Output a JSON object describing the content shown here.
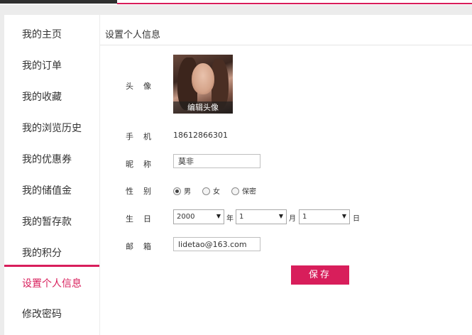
{
  "sidebar": {
    "items": [
      {
        "label": "我的主页"
      },
      {
        "label": "我的订单"
      },
      {
        "label": "我的收藏"
      },
      {
        "label": "我的浏览历史"
      },
      {
        "label": "我的优惠券"
      },
      {
        "label": "我的储值金"
      },
      {
        "label": "我的暂存款"
      },
      {
        "label": "我的积分"
      },
      {
        "label": "设置个人信息",
        "active": true
      },
      {
        "label": "修改密码"
      }
    ]
  },
  "main": {
    "title": "设置个人信息",
    "fields": {
      "avatar": {
        "label": "头像",
        "edit_label": "编辑头像"
      },
      "phone": {
        "label": "手机",
        "value": "18612866301"
      },
      "nickname": {
        "label": "昵称",
        "value": "莫非"
      },
      "gender": {
        "label": "性别",
        "options": [
          {
            "label": "男",
            "selected": true
          },
          {
            "label": "女",
            "selected": false
          },
          {
            "label": "保密",
            "selected": false
          }
        ]
      },
      "birthday": {
        "label": "生日",
        "year": "2000",
        "year_unit": "年",
        "month": "1",
        "month_unit": "月",
        "day": "1",
        "day_unit": "日"
      },
      "email": {
        "label": "邮箱",
        "value": "lidetao@163.com"
      }
    },
    "save_label": "保存"
  },
  "colors": {
    "accent": "#d81e5b",
    "sidebar_bg": "#ffffff",
    "page_bg": "#ececec"
  }
}
